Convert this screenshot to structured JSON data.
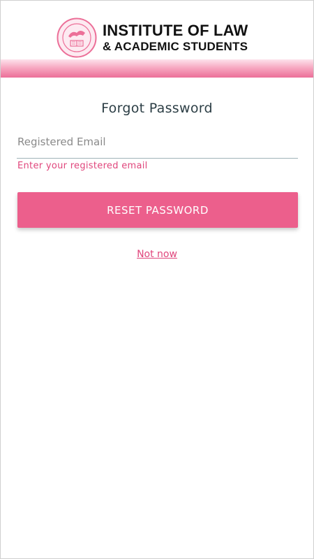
{
  "header": {
    "brand_line1": "INSTITUTE OF LAW",
    "brand_line2": "& ACADEMIC STUDENTS",
    "logo_icon": "institute-seal-icon",
    "accent_color": "#ec6f98"
  },
  "form": {
    "title": "Forgot Password",
    "email_placeholder": "Registered Email",
    "email_value": "",
    "helper_text": "Enter your registered email",
    "reset_button_label": "RESET PASSWORD",
    "not_now_label": "Not now",
    "button_color": "#ec5f8c",
    "helper_color": "#e0467c"
  }
}
